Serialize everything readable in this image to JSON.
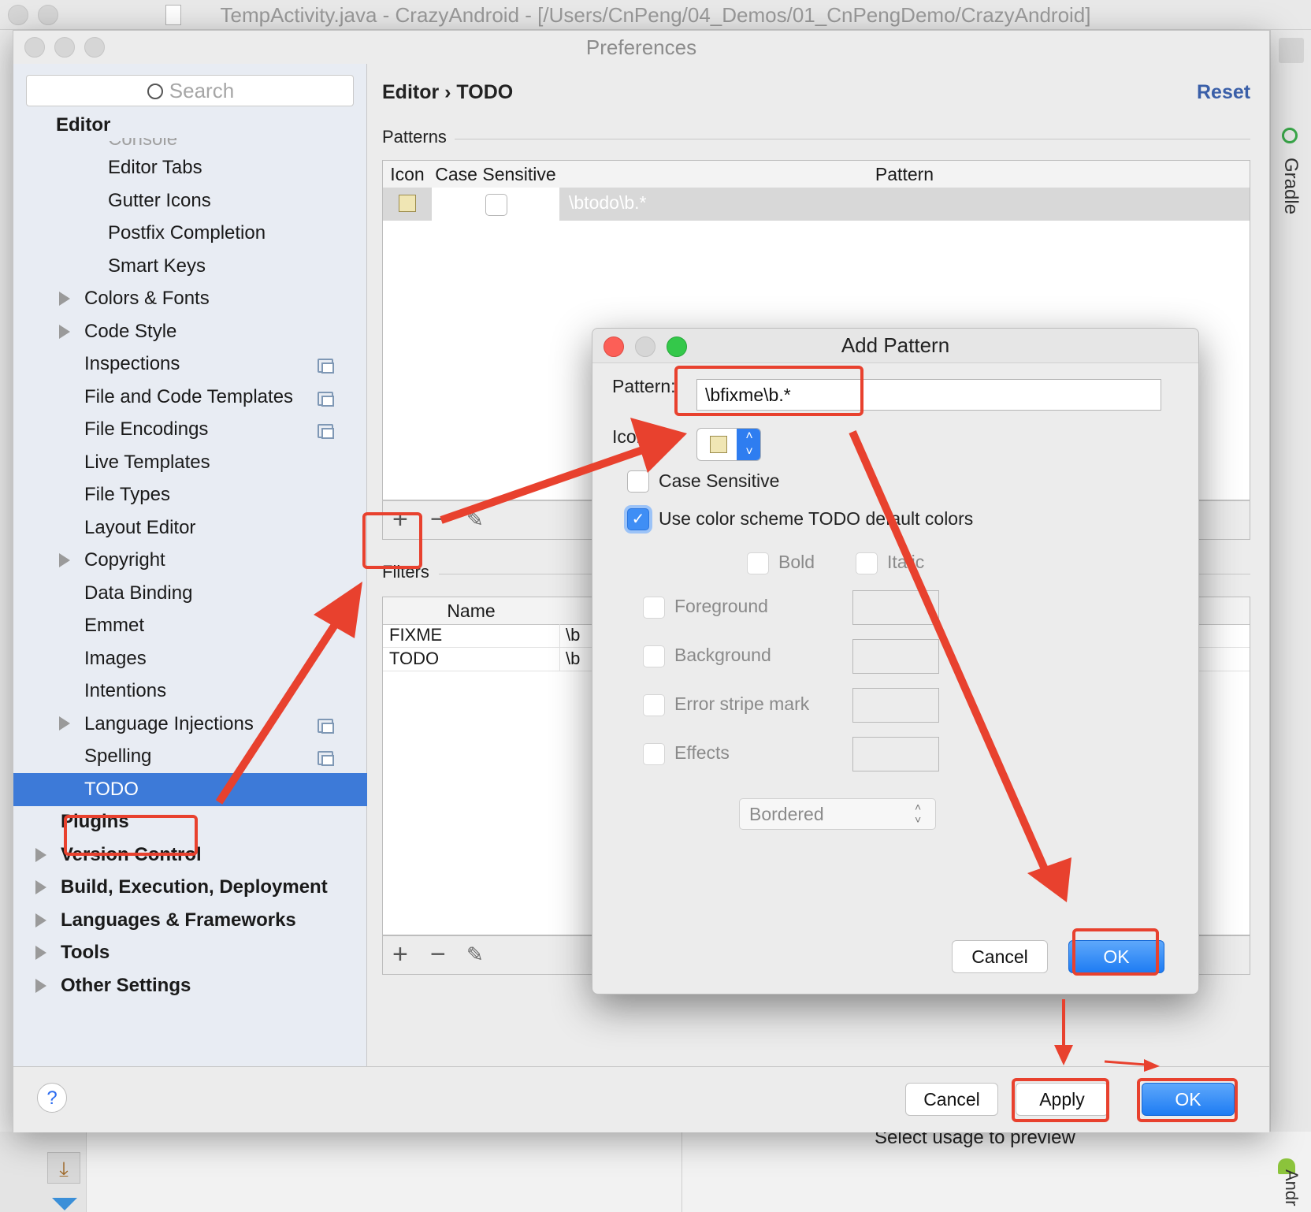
{
  "ide": {
    "window_title": "TempActivity.java - CrazyAndroid - [/Users/CnPeng/04_Demos/01_CnPengDemo/CrazyAndroid]",
    "right_tool": "Gradle",
    "bottom_tool": "Andr",
    "bottom_hint": "Select usage to preview"
  },
  "preferences": {
    "title": "Preferences",
    "search_placeholder": "Search",
    "tree": {
      "root": "Editor",
      "partial_item": "Console",
      "items": [
        "Editor Tabs",
        "Gutter Icons",
        "Postfix Completion",
        "Smart Keys"
      ],
      "items_level2": [
        "Colors & Fonts",
        "Code Style",
        "Inspections",
        "File and Code Templates",
        "File Encodings",
        "Live Templates",
        "File Types",
        "Layout Editor",
        "Copyright",
        "Data Binding",
        "Emmet",
        "Images",
        "Intentions",
        "Language Injections",
        "Spelling",
        "TODO"
      ],
      "top_level": [
        "Plugins",
        "Version Control",
        "Build, Execution, Deployment",
        "Languages & Frameworks",
        "Tools",
        "Other Settings"
      ]
    },
    "breadcrumb": "Editor › TODO",
    "reset": "Reset",
    "patterns": {
      "section": "Patterns",
      "columns": [
        "Icon",
        "Case Sensitive",
        "Pattern"
      ],
      "rows": [
        {
          "pattern": "\\btodo\\b.*"
        }
      ]
    },
    "filters": {
      "section": "Filters",
      "column": "Name",
      "rows": [
        {
          "name": "FIXME",
          "pattern": "\\b"
        },
        {
          "name": "TODO",
          "pattern": "\\b"
        }
      ]
    },
    "footer": {
      "cancel": "Cancel",
      "apply": "Apply",
      "ok": "OK",
      "help": "?"
    }
  },
  "add_pattern": {
    "title": "Add Pattern",
    "pattern_label": "Pattern:",
    "pattern_value": "\\bfixme\\b.*",
    "icon_label": "Icon:",
    "case_sensitive": "Case Sensitive",
    "use_color_scheme": "Use color scheme TODO default colors",
    "bold": "Bold",
    "italic": "Italic",
    "foreground": "Foreground",
    "background": "Background",
    "error_stripe": "Error stripe mark",
    "effects": "Effects",
    "effect_type": "Bordered",
    "cancel": "Cancel",
    "ok": "OK"
  },
  "colors": {
    "selection": "#3d7ad8",
    "primary_button": "#1e7cf3",
    "annotation": "#e8412e",
    "link": "#3a5fa8"
  }
}
